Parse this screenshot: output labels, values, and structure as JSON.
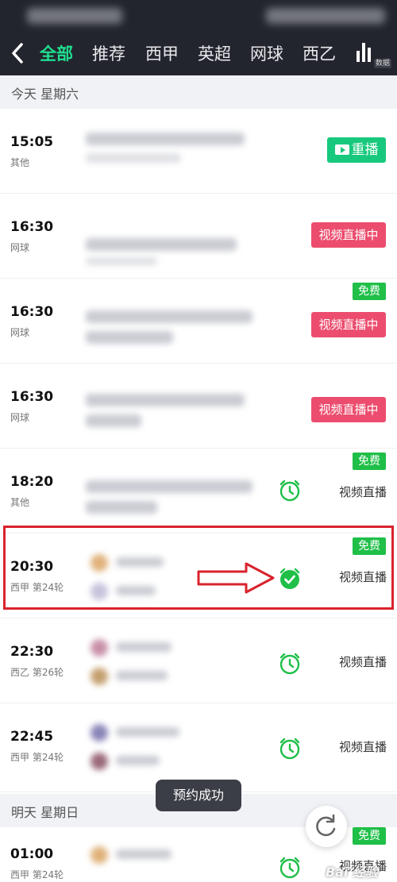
{
  "nav": {
    "tabs": [
      "全部",
      "推荐",
      "西甲",
      "英超",
      "网球",
      "西乙"
    ],
    "active_tab": 0,
    "data_label": "数据"
  },
  "days": [
    {
      "label": "今天  星期六"
    },
    {
      "label": "明天  星期日"
    }
  ],
  "matches": [
    {
      "time": "15:05",
      "sub": "其他",
      "action": "重播",
      "free": ""
    },
    {
      "time": "16:30",
      "sub": "网球",
      "action": "视频直播中",
      "free": ""
    },
    {
      "time": "16:30",
      "sub": "网球",
      "action": "视频直播中",
      "free": "免费"
    },
    {
      "time": "16:30",
      "sub": "网球",
      "action": "视频直播中",
      "free": ""
    },
    {
      "time": "18:20",
      "sub": "其他",
      "action": "视频直播",
      "free": "免费"
    },
    {
      "time": "20:30",
      "sub": "西甲 第24轮",
      "action": "视频直播",
      "free": "免费"
    },
    {
      "time": "22:30",
      "sub": "西乙 第26轮",
      "action": "视频直播",
      "free": ""
    },
    {
      "time": "22:45",
      "sub": "西甲 第24轮",
      "action": "视频直播",
      "free": ""
    },
    {
      "time": "01:00",
      "sub": "西甲 第24轮",
      "action": "视频直播",
      "free": "免费"
    }
  ],
  "toast": "预约成功",
  "watermark": "Bai 经验",
  "colors": {
    "accent_green": "#1fe08f",
    "replay_green": "#18c97d",
    "live_red": "#ec4d6e",
    "free_green": "#1fbf48",
    "highlight_red": "#d9232d",
    "header_bg": "#23252e"
  }
}
